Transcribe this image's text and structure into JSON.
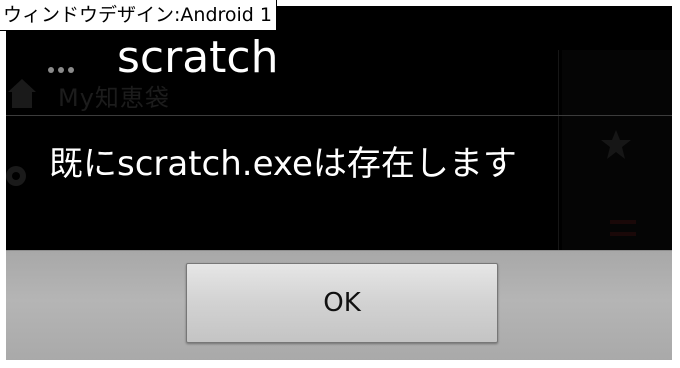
{
  "caption": "ウィンドウデザイン:Android 1",
  "dialog": {
    "title": "scratch",
    "message": "既にscratch.exeは存在します",
    "ok_label": "OK"
  },
  "background_app": {
    "title_fragment": "My知恵袋"
  },
  "icons": {
    "overflow": "overflow-menu-icon",
    "home": "home-icon",
    "gear": "gear-icon"
  },
  "colors": {
    "dialog_background": "#000000",
    "button_bar": "#b0b0b0",
    "button": "#d6d6d6",
    "text_light": "#ffffff"
  }
}
